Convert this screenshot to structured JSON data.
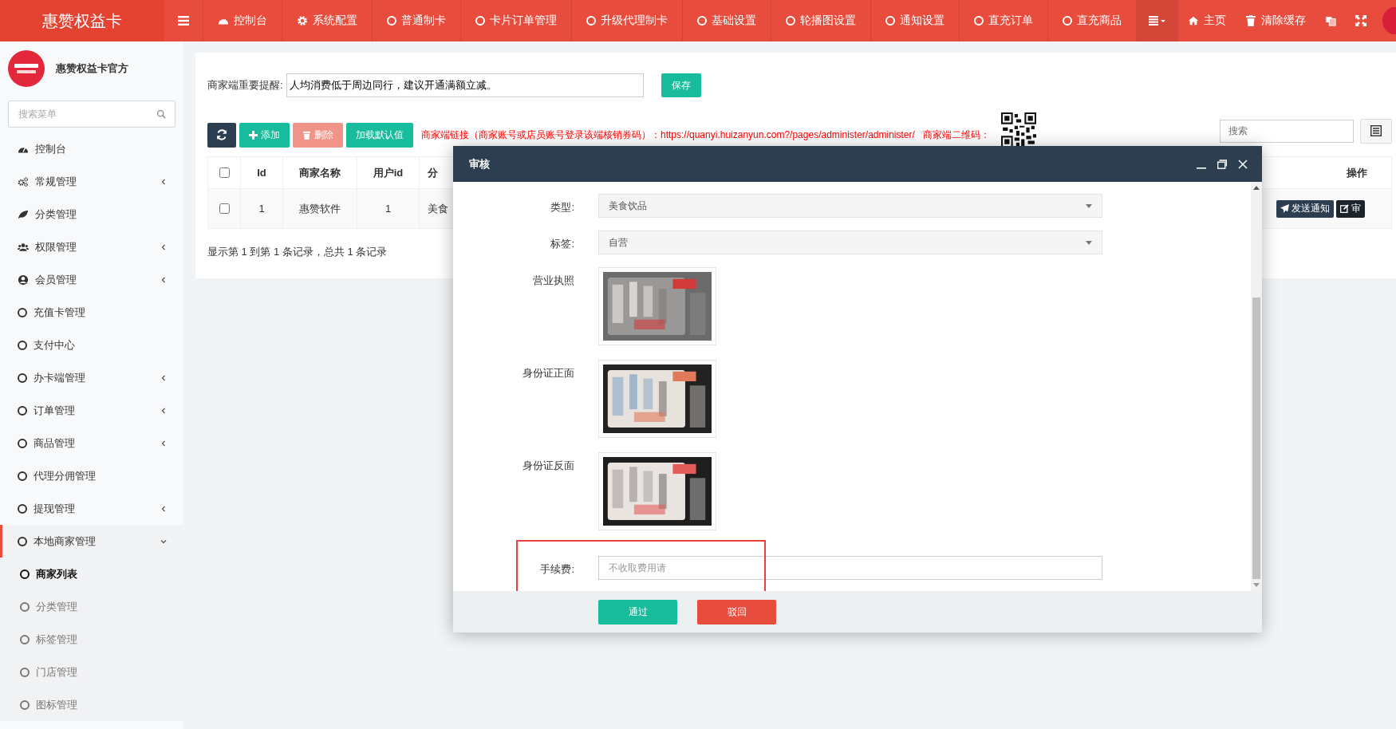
{
  "topbar": {
    "brand": "惠赞权益卡",
    "nav": [
      {
        "label": "控制台"
      },
      {
        "label": "系统配置"
      },
      {
        "label": "普通制卡"
      },
      {
        "label": "卡片订单管理"
      },
      {
        "label": "升级代理制卡"
      },
      {
        "label": "基础设置"
      },
      {
        "label": "轮播图设置"
      },
      {
        "label": "通知设置"
      },
      {
        "label": "直充订单"
      },
      {
        "label": "直充商品"
      }
    ],
    "right": [
      {
        "label": "主页"
      },
      {
        "label": "清除缓存"
      }
    ]
  },
  "sidebar": {
    "account": "惠赞权益卡官方",
    "search_placeholder": "搜索菜单",
    "items": [
      {
        "label": "控制台",
        "has_submenu": false,
        "expanded": false,
        "selected": false
      },
      {
        "label": "常规管理",
        "has_submenu": true,
        "expanded": false,
        "selected": false
      },
      {
        "label": "分类管理",
        "has_submenu": false,
        "expanded": false,
        "selected": false
      },
      {
        "label": "权限管理",
        "has_submenu": true,
        "expanded": false,
        "selected": false
      },
      {
        "label": "会员管理",
        "has_submenu": true,
        "expanded": false,
        "selected": false
      },
      {
        "label": "充值卡管理",
        "has_submenu": false,
        "expanded": false,
        "selected": false
      },
      {
        "label": "支付中心",
        "has_submenu": false,
        "expanded": false,
        "selected": false
      },
      {
        "label": "办卡端管理",
        "has_submenu": true,
        "expanded": false,
        "selected": false
      },
      {
        "label": "订单管理",
        "has_submenu": true,
        "expanded": false,
        "selected": false
      },
      {
        "label": "商品管理",
        "has_submenu": true,
        "expanded": false,
        "selected": false
      },
      {
        "label": "代理分佣管理",
        "has_submenu": false,
        "expanded": false,
        "selected": false
      },
      {
        "label": "提现管理",
        "has_submenu": true,
        "expanded": false,
        "selected": false
      },
      {
        "label": "本地商家管理",
        "has_submenu": true,
        "expanded": true,
        "selected": true,
        "children": [
          {
            "label": "商家列表",
            "selected": true
          },
          {
            "label": "分类管理",
            "selected": false
          },
          {
            "label": "标签管理",
            "selected": false
          },
          {
            "label": "门店管理",
            "selected": false
          },
          {
            "label": "图标管理",
            "selected": false
          }
        ]
      }
    ]
  },
  "main": {
    "reminder": {
      "label": "商家端重要提醒:",
      "value": "人均消费低于周边同行，建议开通满额立减。"
    },
    "save_button": "保存",
    "toolbar": [
      {
        "label": "添加",
        "disabled": false,
        "kind": "add"
      },
      {
        "label": "删除",
        "disabled": true,
        "kind": "delete"
      },
      {
        "label": "加载默认值",
        "disabled": false,
        "kind": "default"
      }
    ],
    "link_notice": "商家端链接（商家账号或店员账号登录该端核销券码）：https://quanyi.huizanyun.com?/pages/administer/administer/",
    "qr_label": "商家端二维码：",
    "search_placeholder": "搜索",
    "table": {
      "select_all_checked": false,
      "columns": [
        "Id",
        "商家名称",
        "用户id",
        "分",
        "操作"
      ],
      "rows": [
        {
          "checked": false,
          "cells": [
            "1",
            "惠赞软件",
            "1",
            "美食"
          ],
          "actions": [
            "发送通知",
            "审"
          ]
        }
      ]
    },
    "pagination": "显示第 1 到第 1 条记录，总共 1 条记录"
  },
  "dialog": {
    "title": "审核",
    "fields": [
      {
        "kind": "select",
        "label": "类型:",
        "value": "美食饮品"
      },
      {
        "kind": "select",
        "label": "标签:",
        "value": "自营"
      },
      {
        "label": "营业执照"
      },
      {
        "label": "身份证正面"
      },
      {
        "label": "身份证反面"
      },
      {
        "kind": "input",
        "label": "手续费:",
        "placeholder": "不收取费用请",
        "highlighted": true
      }
    ],
    "buttons": [
      {
        "label": "通过",
        "kind": "primary"
      },
      {
        "label": "驳回",
        "kind": "danger"
      }
    ]
  }
}
